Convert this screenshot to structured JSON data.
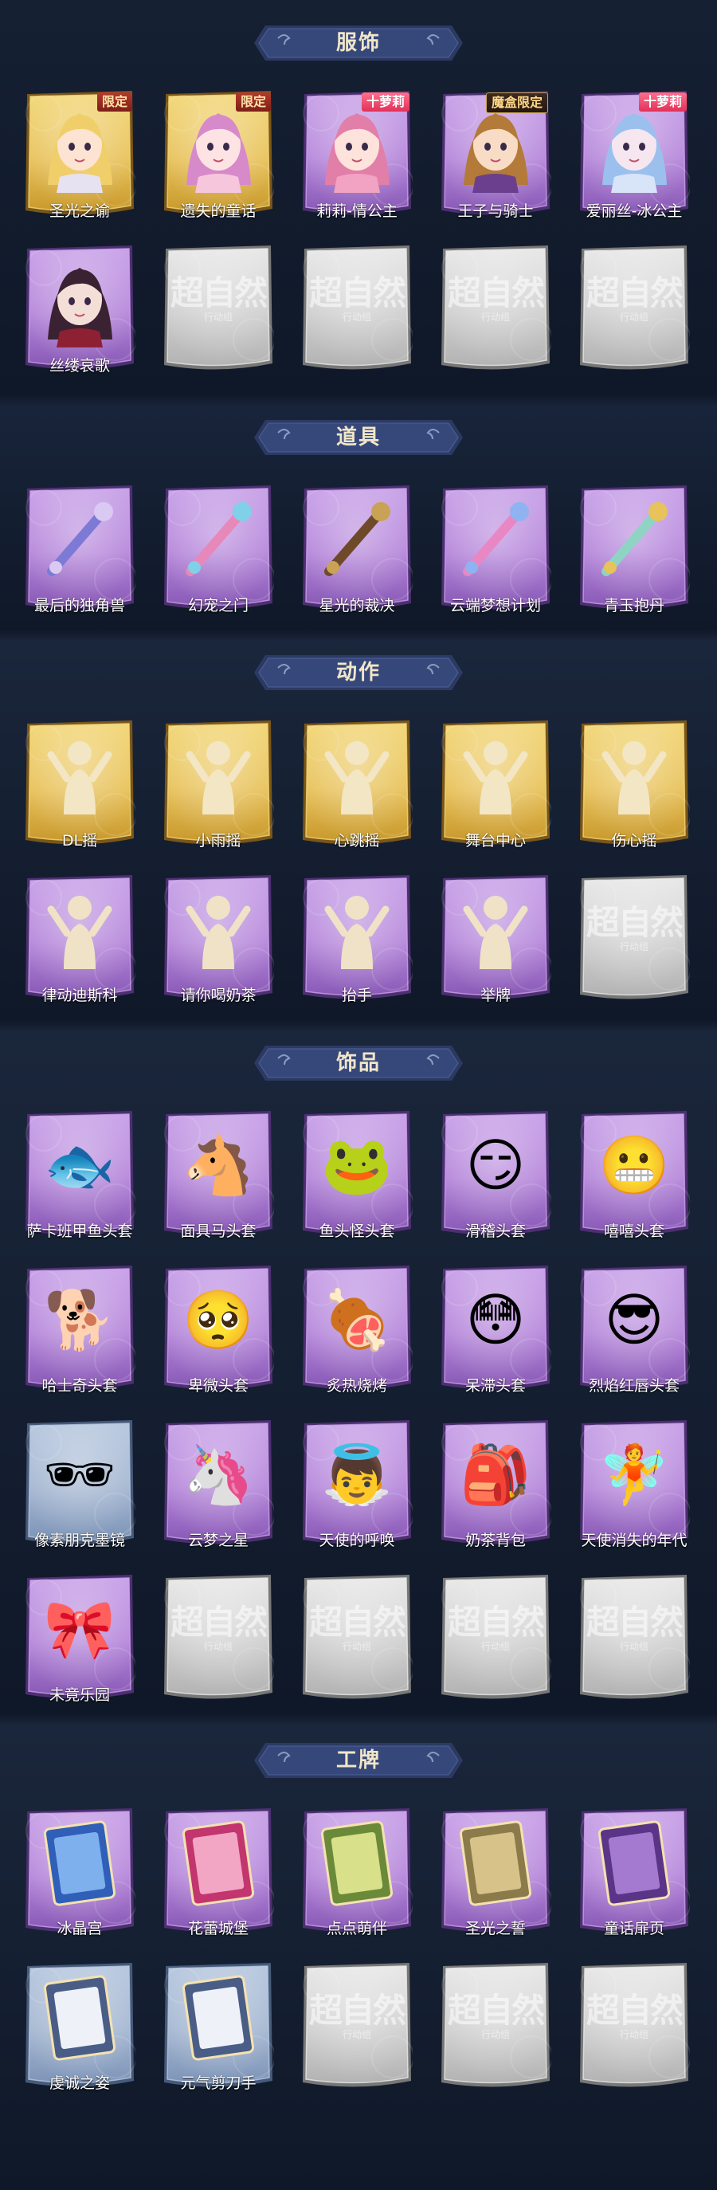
{
  "sections": [
    {
      "key": "costume",
      "title": "服饰",
      "items": [
        {
          "label": "圣光之谕",
          "bg": "gold",
          "badge": "限定",
          "badge_style": "limited",
          "icon": "blonde-girl-portrait"
        },
        {
          "label": "遗失的童话",
          "bg": "gold",
          "badge": "限定",
          "badge_style": "limited",
          "icon": "pink-hair-girl-portrait"
        },
        {
          "label": "莉莉-情公主",
          "bg": "purple",
          "badge": "十萝莉",
          "badge_style": "pink",
          "icon": "pink-hair-blindfold-portrait"
        },
        {
          "label": "王子与骑士",
          "bg": "purple",
          "badge": "魔盒限定",
          "badge_style": "blind",
          "icon": "prince-hat-portrait"
        },
        {
          "label": "爱丽丝-冰公主",
          "bg": "purple",
          "badge": "十萝莉",
          "badge_style": "pink",
          "icon": "ice-princess-portrait"
        },
        {
          "label": "丝缕哀歌",
          "bg": "purple",
          "badge": "",
          "badge_style": "",
          "icon": "dark-hair-girl-portrait"
        },
        {
          "label": "",
          "bg": "locked",
          "icon": "locked-placeholder"
        },
        {
          "label": "",
          "bg": "locked",
          "icon": "locked-placeholder"
        },
        {
          "label": "",
          "bg": "locked",
          "icon": "locked-placeholder"
        },
        {
          "label": "",
          "bg": "locked",
          "icon": "locked-placeholder"
        }
      ]
    },
    {
      "key": "props",
      "title": "道具",
      "items": [
        {
          "label": "最后的独角兽",
          "bg": "purple",
          "icon": "unicorn-sword-icon"
        },
        {
          "label": "幻宠之门",
          "bg": "purple",
          "icon": "pet-portal-device-icon"
        },
        {
          "label": "星光的裁决",
          "bg": "purple",
          "icon": "starlight-gun-icon"
        },
        {
          "label": "云端梦想计划",
          "bg": "purple",
          "icon": "cloud-scepter-icon"
        },
        {
          "label": "青玉抱丹",
          "bg": "purple",
          "icon": "jade-vase-icon"
        }
      ]
    },
    {
      "key": "actions",
      "title": "动作",
      "items": [
        {
          "label": "DL摇",
          "bg": "gold",
          "icon": "dance-pose-icon"
        },
        {
          "label": "小雨摇",
          "bg": "gold",
          "icon": "dance-pose-icon"
        },
        {
          "label": "心跳摇",
          "bg": "gold",
          "icon": "heartbeat-pose-icon"
        },
        {
          "label": "舞台中心",
          "bg": "gold",
          "icon": "center-stage-pose-icon"
        },
        {
          "label": "伤心摇",
          "bg": "gold",
          "icon": "heart-hands-pose-icon"
        },
        {
          "label": "律动迪斯科",
          "bg": "purple",
          "icon": "disco-pose-icon"
        },
        {
          "label": "请你喝奶茶",
          "bg": "purple",
          "icon": "milk-tea-pose-icon"
        },
        {
          "label": "抬手",
          "bg": "purple",
          "icon": "raise-hand-pose-icon"
        },
        {
          "label": "举牌",
          "bg": "purple",
          "icon": "sign-holding-pose-icon"
        },
        {
          "label": "",
          "bg": "locked",
          "icon": "locked-placeholder"
        }
      ]
    },
    {
      "key": "accessories",
      "title": "饰品",
      "items": [
        {
          "label": "萨卡班甲鱼头套",
          "bg": "purple",
          "icon": "fish-head-mask-icon",
          "glyph": "🐟"
        },
        {
          "label": "面具马头套",
          "bg": "purple",
          "icon": "horse-head-mask-icon",
          "glyph": "🐴"
        },
        {
          "label": "鱼头怪头套",
          "bg": "purple",
          "icon": "fish-monster-mask-icon",
          "glyph": "🐸"
        },
        {
          "label": "滑稽头套",
          "bg": "purple",
          "icon": "funny-face-mask-icon",
          "glyph": "😏"
        },
        {
          "label": "嘻嘻头套",
          "bg": "purple",
          "icon": "grin-face-mask-icon",
          "glyph": "😬"
        },
        {
          "label": "哈士奇头套",
          "bg": "purple",
          "icon": "husky-mask-icon",
          "glyph": "🐕"
        },
        {
          "label": "卑微头套",
          "bg": "purple",
          "icon": "humble-face-mask-icon",
          "glyph": "🥺"
        },
        {
          "label": "炙热烧烤",
          "bg": "purple",
          "icon": "bbq-mask-icon",
          "glyph": "🍖"
        },
        {
          "label": "呆滞头套",
          "bg": "purple",
          "icon": "dazed-face-mask-icon",
          "glyph": "😳"
        },
        {
          "label": "烈焰红唇头套",
          "bg": "purple",
          "icon": "pikachu-lips-mask-icon",
          "glyph": "😎"
        },
        {
          "label": "像素朋克墨镜",
          "bg": "blue",
          "icon": "pixel-sunglasses-icon",
          "glyph": "🕶"
        },
        {
          "label": "云梦之星",
          "bg": "purple",
          "icon": "cloud-star-pet-icon",
          "glyph": "🦄"
        },
        {
          "label": "天使的呼唤",
          "bg": "purple",
          "icon": "angel-call-icon",
          "glyph": "👼"
        },
        {
          "label": "奶茶背包",
          "bg": "purple",
          "icon": "milk-tea-bag-icon",
          "glyph": "🎒"
        },
        {
          "label": "天使消失的年代",
          "bg": "purple",
          "icon": "angel-doll-icon",
          "glyph": "🧚"
        },
        {
          "label": "未竟乐园",
          "bg": "purple",
          "icon": "paradise-doll-icon",
          "glyph": "🎀"
        },
        {
          "label": "",
          "bg": "locked",
          "icon": "locked-placeholder"
        },
        {
          "label": "",
          "bg": "locked",
          "icon": "locked-placeholder"
        },
        {
          "label": "",
          "bg": "locked",
          "icon": "locked-placeholder"
        },
        {
          "label": "",
          "bg": "locked",
          "icon": "locked-placeholder"
        }
      ]
    },
    {
      "key": "badges",
      "title": "工牌",
      "items": [
        {
          "label": "冰晶宫",
          "bg": "purple",
          "icon": "ice-palace-card-icon"
        },
        {
          "label": "花蕾城堡",
          "bg": "purple",
          "icon": "flower-castle-card-icon"
        },
        {
          "label": "点点萌伴",
          "bg": "purple",
          "icon": "cute-companion-card-icon"
        },
        {
          "label": "圣光之誓",
          "bg": "purple",
          "icon": "holy-oath-card-icon"
        },
        {
          "label": "童话扉页",
          "bg": "purple",
          "icon": "fairy-page-card-icon"
        },
        {
          "label": "虔诚之姿",
          "bg": "blue",
          "icon": "devout-silhouette-card-icon"
        },
        {
          "label": "元气剪刀手",
          "bg": "blue",
          "icon": "peace-sign-silhouette-card-icon"
        },
        {
          "label": "",
          "bg": "locked",
          "icon": "locked-placeholder"
        },
        {
          "label": "",
          "bg": "locked",
          "icon": "locked-placeholder"
        },
        {
          "label": "",
          "bg": "locked",
          "icon": "locked-placeholder"
        }
      ]
    }
  ],
  "placeholder": {
    "title": "超自然",
    "subtitle": "行动组"
  },
  "colors": {
    "gold": "#d9b24a",
    "purple": "#8b5fb8",
    "blue": "#7b93b7",
    "locked": "#b5b5b5",
    "banner": "#2c3a63"
  }
}
